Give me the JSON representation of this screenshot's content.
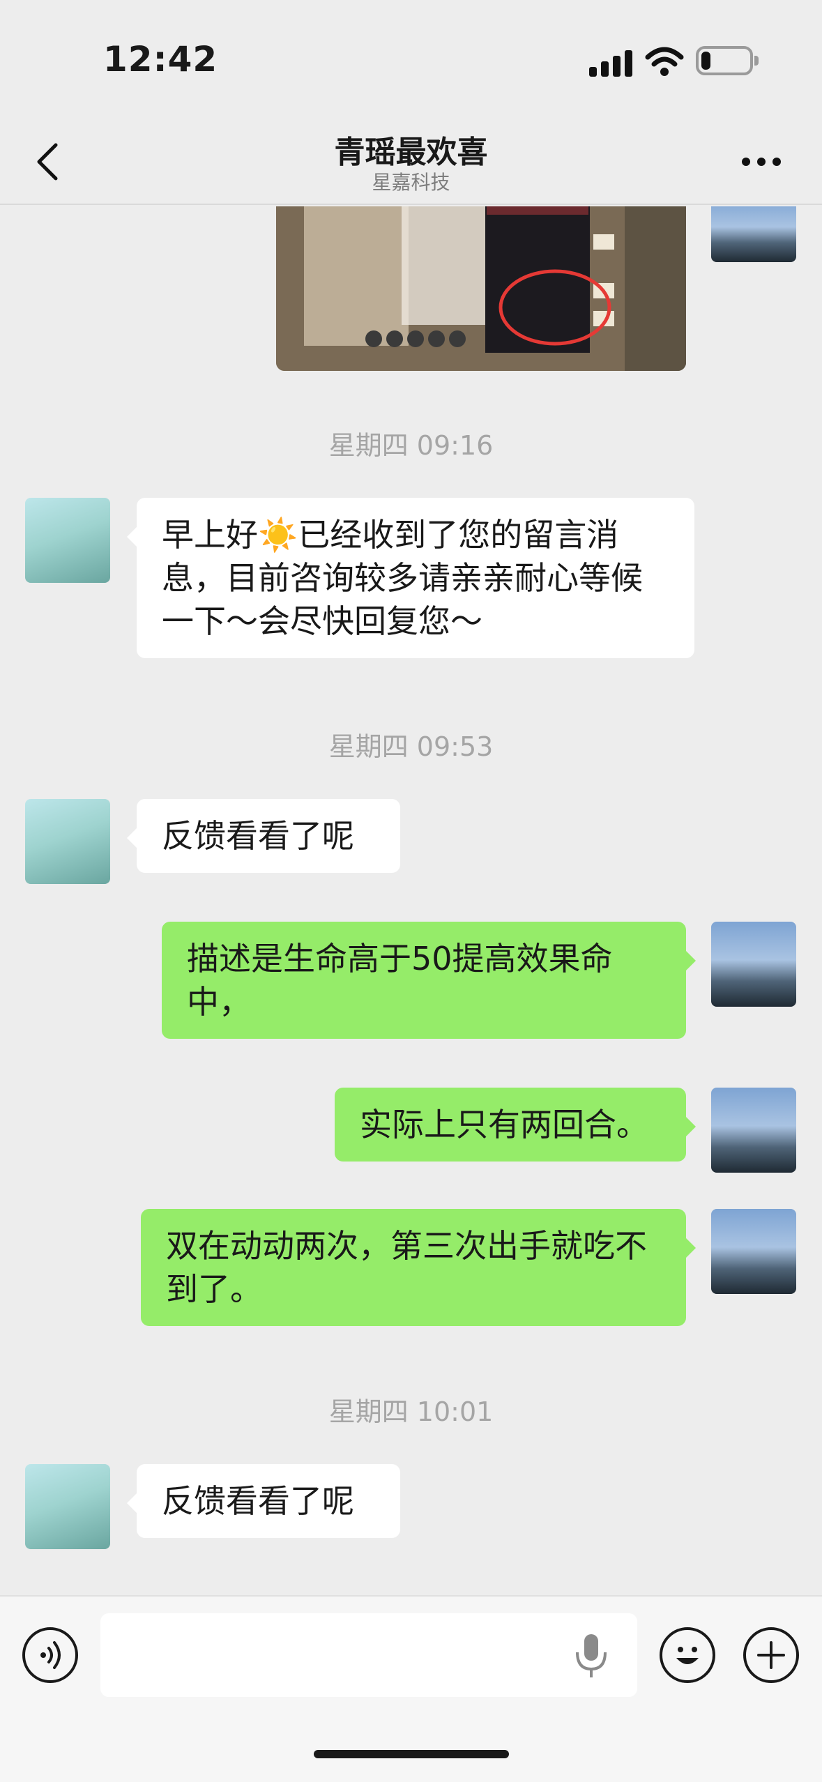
{
  "status_bar": {
    "time": "12:42",
    "battery_level_percent": 20
  },
  "nav": {
    "back_icon": "chevron-left-icon",
    "title": "青瑶最欢喜",
    "subtitle": "星嘉科技",
    "more_icon": "more-horizontal-icon"
  },
  "messages": {
    "t1": "星期四 09:16",
    "m1": "早上好☀️已经收到了您的留言消息，目前咨询较多请亲亲耐心等候一下～会尽快回复您～",
    "t2": "星期四 09:53",
    "m2": "反馈看看了呢",
    "m3": "描述是生命高于50提高效果命中，",
    "m4": "实际上只有两回合。",
    "m5": "双在动动两次，第三次出手就吃不到了。",
    "t3": "星期四 10:01",
    "m6": "反馈看看了呢"
  },
  "input_bar": {
    "voice_icon": "voice-icon",
    "placeholder": "",
    "mic_icon": "microphone-icon",
    "emoji_icon": "emoji-icon",
    "plus_icon": "plus-icon"
  },
  "colors": {
    "outgoing_bubble": "#95ec69",
    "incoming_bubble": "#ffffff",
    "background": "#ededed"
  }
}
